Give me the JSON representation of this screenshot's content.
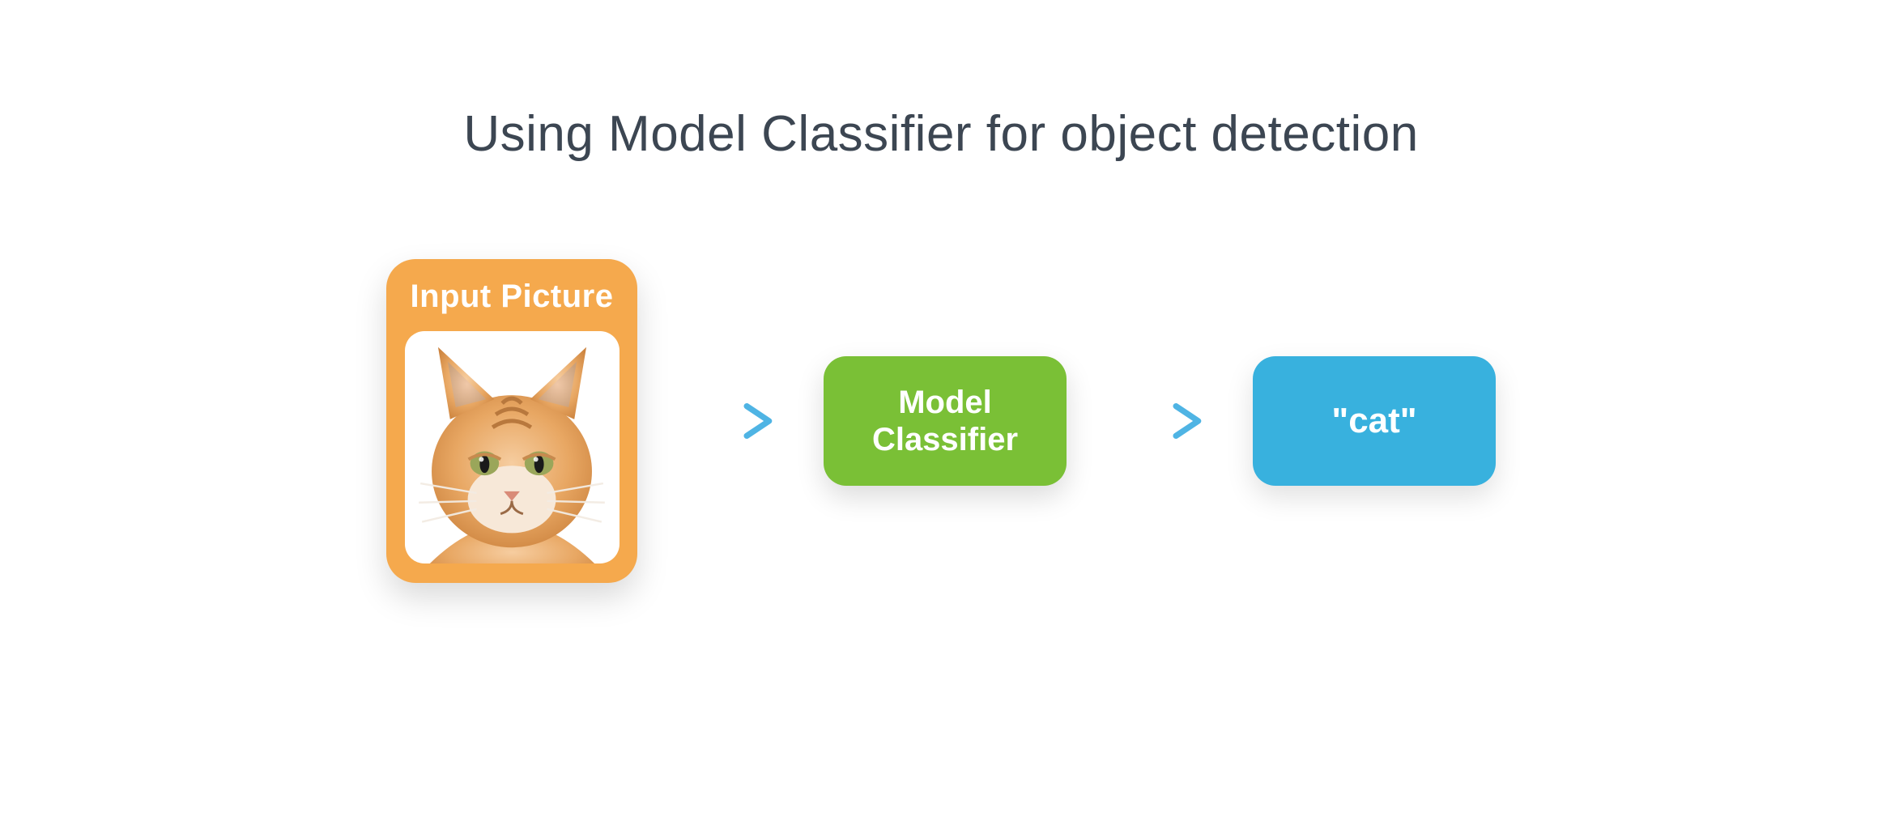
{
  "title": "Using Model Classifier for object detection",
  "input": {
    "label": "Input Picture",
    "image_description": "orange tabby cat face"
  },
  "model": {
    "label": "Model\nClassifier"
  },
  "output": {
    "label": "\"cat\""
  },
  "colors": {
    "input_card": "#f5a94d",
    "model_box": "#7ac036",
    "output_box": "#38b1de",
    "arrow": "#5bb9e6",
    "title_text": "#3c4652"
  }
}
